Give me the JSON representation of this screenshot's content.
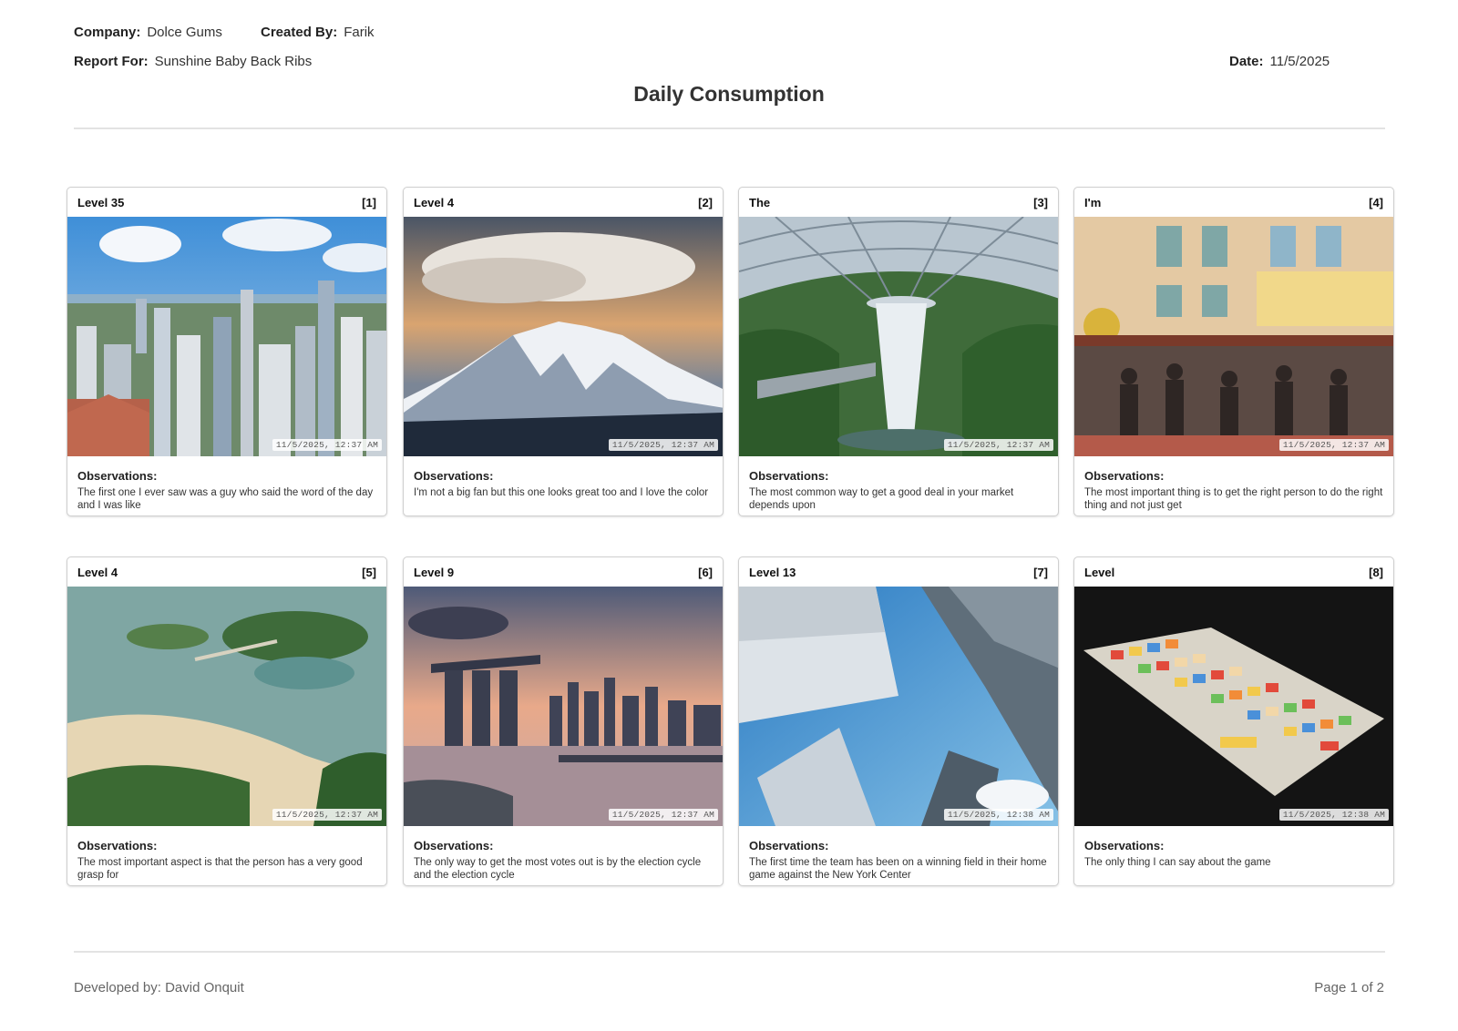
{
  "header": {
    "company_label": "Company:",
    "company_value": "Dolce Gums",
    "created_by_label": "Created By:",
    "created_by_value": "Farik",
    "report_for_label": "Report For:",
    "report_for_value": "Sunshine Baby Back Ribs",
    "date_label": "Date:",
    "date_value": "11/5/2025",
    "title": "Daily Consumption"
  },
  "cards": [
    {
      "title": "Level 35",
      "index": "[1]",
      "timestamp": "11/5/2025, 12:37 AM",
      "obs_label": "Observations:",
      "obs_text": "The first one I ever saw was a guy who said the word of the day and I was like",
      "image": "singapore-skyline-photo"
    },
    {
      "title": "Level 4",
      "index": "[2]",
      "timestamp": "11/5/2025, 12:37 AM",
      "obs_label": "Observations:",
      "obs_text": "I'm not a big fan but this one looks great too and I love the color",
      "image": "snowy-mountain-photo"
    },
    {
      "title": "The",
      "index": "[3]",
      "timestamp": "11/5/2025, 12:37 AM",
      "obs_label": "Observations:",
      "obs_text": "The most common way to get a good deal in your market depends upon",
      "image": "indoor-waterfall-photo"
    },
    {
      "title": "I'm",
      "index": "[4]",
      "timestamp": "11/5/2025, 12:37 AM",
      "obs_label": "Observations:",
      "obs_text": "The most important thing is to get the right person to do the right thing and not just get",
      "image": "chinatown-street-photo"
    },
    {
      "title": "Level 4",
      "index": "[5]",
      "timestamp": "11/5/2025, 12:37 AM",
      "obs_label": "Observations:",
      "obs_text": "The most important aspect is that the person has a very good grasp for",
      "image": "island-beach-photo"
    },
    {
      "title": "Level 9",
      "index": "[6]",
      "timestamp": "11/5/2025, 12:37 AM",
      "obs_label": "Observations:",
      "obs_text": "The only way to get the most votes out is by the election cycle and the election cycle",
      "image": "marina-bay-sunset-photo"
    },
    {
      "title": "Level 13",
      "index": "[7]",
      "timestamp": "11/5/2025, 12:38 AM",
      "obs_label": "Observations:",
      "obs_text": "The first time the team has been on a winning field in their home game against the New York Center",
      "image": "skyscrapers-upward-photo"
    },
    {
      "title": "Level",
      "index": "[8]",
      "timestamp": "11/5/2025, 12:38 AM",
      "obs_label": "Observations:",
      "obs_text": "The only thing I can say about the game",
      "image": "colorful-keyboard-photo"
    }
  ],
  "footer": {
    "developed_by": "Developed by: David Onquit",
    "page": "Page 1 of 2"
  }
}
